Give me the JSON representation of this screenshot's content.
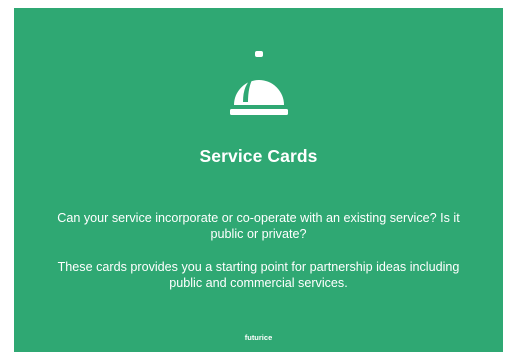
{
  "card": {
    "background_color": "#2fa873",
    "text_color": "#ffffff",
    "icon": "service-bell-icon",
    "title": "Service Cards",
    "paragraph_1": "Can your service incorporate or co-operate with an existing service? Is it public or private?",
    "paragraph_2": "These cards provides you a starting point for partnership ideas including public and commercial services.",
    "brand": "futurice"
  }
}
